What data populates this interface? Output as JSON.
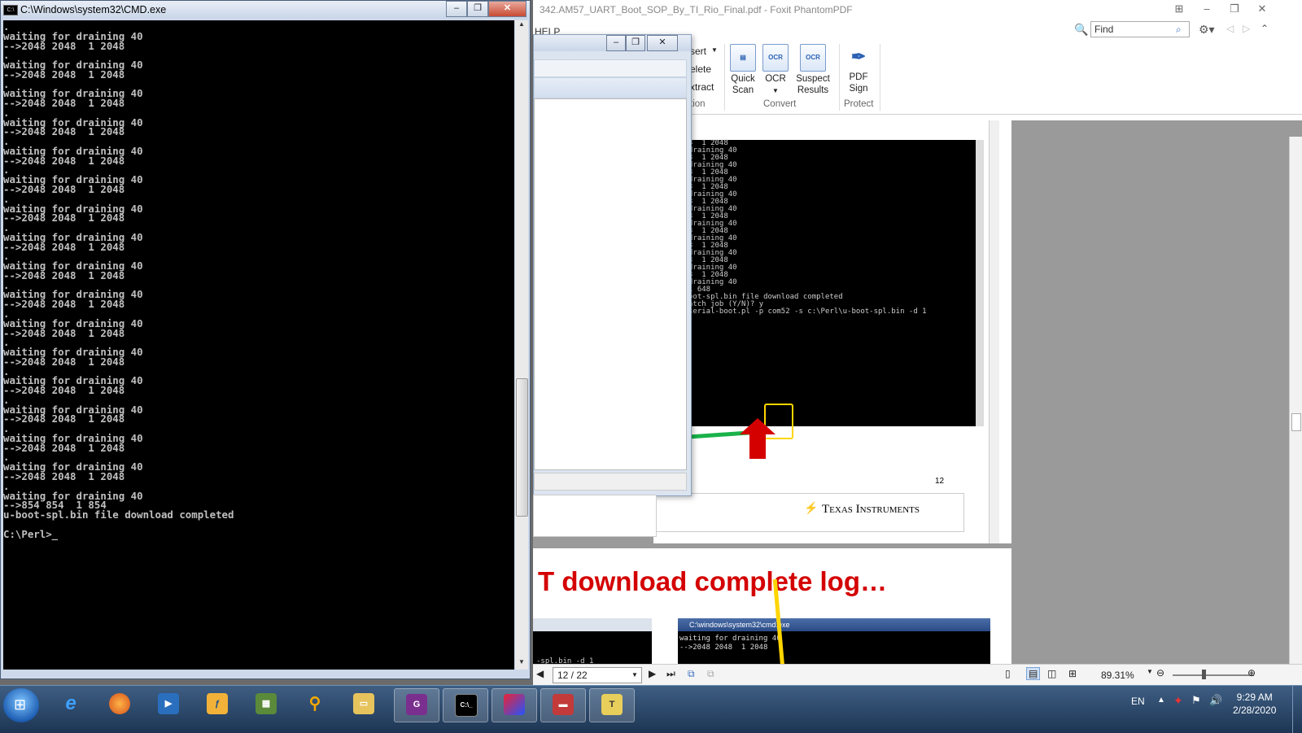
{
  "foxit": {
    "title": "342.AM57_UART_Boot_SOP_By_TI_Rio_Final.pdf - Foxit PhantomPDF",
    "menu_help": "HELP",
    "find_placeholder": "Find",
    "ribbon": {
      "insert": "sert",
      "delete": "elete",
      "extract": "xtract",
      "group_pages": "tion",
      "quick_scan": "Quick Scan",
      "ocr": "OCR",
      "suspect_results": "Suspect Results",
      "group_convert": "Convert",
      "pdf_sign": "PDF Sign",
      "group_protect": "Protect"
    },
    "page": {
      "terminal_lines": [
        "3  1 2048",
        "draining 40",
        "3  1 2048",
        "draining 40",
        "3  1 2048",
        "draining 40",
        "3  1 2048",
        "draining 40",
        "3  1 2048",
        "draining 40",
        "3  1 2048",
        "draining 40",
        "3  1 2048",
        "draining 40",
        "3  1 2048",
        "draining 40",
        "3  1 2048",
        "draining 40",
        "3  1 2048",
        "draining 40",
        "1 648",
        "oot-spl.bin file download completed",
        "",
        "atch job (Y/N)? y",
        "serial-boot.pl -p com52 -s c:\\Perl\\u-boot-spl.bin -d 1"
      ],
      "page_number": "12",
      "brand": "Texas Instruments",
      "heading": "T download complete log…",
      "mini_title": "C:\\windows\\system32\\cmd.exe",
      "mini_lines": [
        "waiting for draining 40",
        "-->2048 2048  1 2048"
      ],
      "mini_left_line": "-spl.bin -d 1"
    },
    "status": {
      "page_box": "12 / 22",
      "zoom": "89.31%"
    }
  },
  "cmd": {
    "title": "C:\\Windows\\system32\\CMD.exe",
    "minimize": "‒",
    "restore": "❐",
    "close": "✕",
    "output": ".\nwaiting for draining 40\n-->2048 2048  1 2048\n.\nwaiting for draining 40\n-->2048 2048  1 2048\n.\nwaiting for draining 40\n-->2048 2048  1 2048\n.\nwaiting for draining 40\n-->2048 2048  1 2048\n.\nwaiting for draining 40\n-->2048 2048  1 2048\n.\nwaiting for draining 40\n-->2048 2048  1 2048\n.\nwaiting for draining 40\n-->2048 2048  1 2048\n.\nwaiting for draining 40\n-->2048 2048  1 2048\n.\nwaiting for draining 40\n-->2048 2048  1 2048\n.\nwaiting for draining 40\n-->2048 2048  1 2048\n.\nwaiting for draining 40\n-->2048 2048  1 2048\n.\nwaiting for draining 40\n-->2048 2048  1 2048\n.\nwaiting for draining 40\n-->2048 2048  1 2048\n.\nwaiting for draining 40\n-->2048 2048  1 2048\n.\nwaiting for draining 40\n-->2048 2048  1 2048\n.\nwaiting for draining 40\n-->2048 2048  1 2048\n.\nwaiting for draining 40\n-->854 854  1 854\nu-boot-spl.bin file download completed\n\nC:\\Perl>_"
  },
  "taskbar": {
    "language": "EN",
    "time": "9:29 AM",
    "date": "2/28/2020",
    "apps": [
      "ie-icon",
      "firefox-icon",
      "media-icon",
      "app-icon",
      "app2-icon",
      "magnifier-icon",
      "explorer-icon",
      "foxit-icon",
      "cmd-icon",
      "paint-icon",
      "toolbox-icon",
      "tool-icon"
    ]
  },
  "colors": {
    "ti_red": "#d40000",
    "heading_red": "#d40000",
    "highlight_yellow": "#ffd500",
    "arrow_green": "#19b24a"
  }
}
